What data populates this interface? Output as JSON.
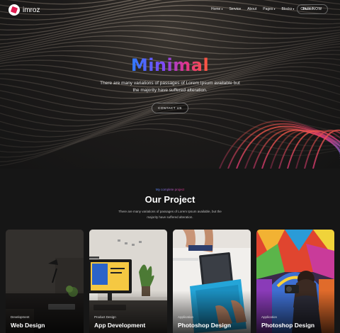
{
  "brand": {
    "name": "imroz"
  },
  "nav": {
    "items": [
      {
        "label": "Home",
        "dropdown": true
      },
      {
        "label": "Service",
        "dropdown": false
      },
      {
        "label": "About",
        "dropdown": false
      },
      {
        "label": "Pages",
        "dropdown": true
      },
      {
        "label": "Blocks",
        "dropdown": true
      },
      {
        "label": "Contact",
        "dropdown": false
      }
    ],
    "cta": "BUY NOW"
  },
  "hero": {
    "title": "Minimal",
    "subtitle": "There are many variations of passages of Lorem Ipsum available but the majority have suffered alteration.",
    "button": "CONTACT US"
  },
  "projects": {
    "kicker": "My complete project",
    "title": "Our Project",
    "subtitle": "There are many variations of passages of Lorem Ipsum available, but the majority have suffered alteration.",
    "cards": [
      {
        "category": "Development",
        "title": "Web Design"
      },
      {
        "category": "Product Design",
        "title": "App Development"
      },
      {
        "category": "Application",
        "title": "Photoshop Design"
      },
      {
        "category": "Application",
        "title": "Photoshop Design"
      }
    ]
  },
  "colors": {
    "background": "#161616",
    "gradient_start": "#2e7bff",
    "gradient_mid": "#e0338a",
    "gradient_end": "#ff5a3c"
  }
}
